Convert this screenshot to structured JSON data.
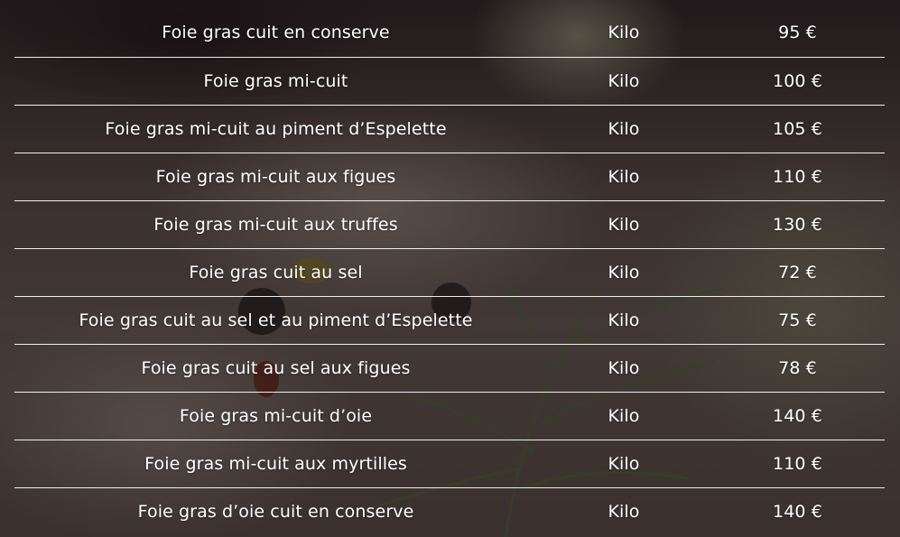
{
  "menu": {
    "rows": [
      {
        "name": "Foie gras cuit en conserve",
        "unit": "Kilo",
        "price": "95 €"
      },
      {
        "name": "Foie gras mi-cuit",
        "unit": "Kilo",
        "price": "100 €"
      },
      {
        "name": "Foie gras mi-cuit au piment d’Espelette",
        "unit": "Kilo",
        "price": "105 €"
      },
      {
        "name": "Foie gras mi-cuit aux figues",
        "unit": "Kilo",
        "price": "110 €"
      },
      {
        "name": "Foie gras mi-cuit aux truffes",
        "unit": "Kilo",
        "price": "130 €"
      },
      {
        "name": "Foie gras cuit au sel",
        "unit": "Kilo",
        "price": "72 €"
      },
      {
        "name": "Foie gras cuit au sel et au piment d’Espelette",
        "unit": "Kilo",
        "price": "75 €"
      },
      {
        "name": "Foie gras cuit au sel aux figues",
        "unit": "Kilo",
        "price": "78 €"
      },
      {
        "name": "Foie gras mi-cuit d’oie",
        "unit": "Kilo",
        "price": "140 €"
      },
      {
        "name": "Foie gras mi-cuit aux myrtilles",
        "unit": "Kilo",
        "price": "110 €"
      },
      {
        "name": "Foie gras d’oie cuit en conserve",
        "unit": "Kilo",
        "price": "140 €"
      }
    ]
  },
  "colors": {
    "text": "#ffffff",
    "divider": "#ffffff",
    "background_tint": "#4a3f3b"
  }
}
